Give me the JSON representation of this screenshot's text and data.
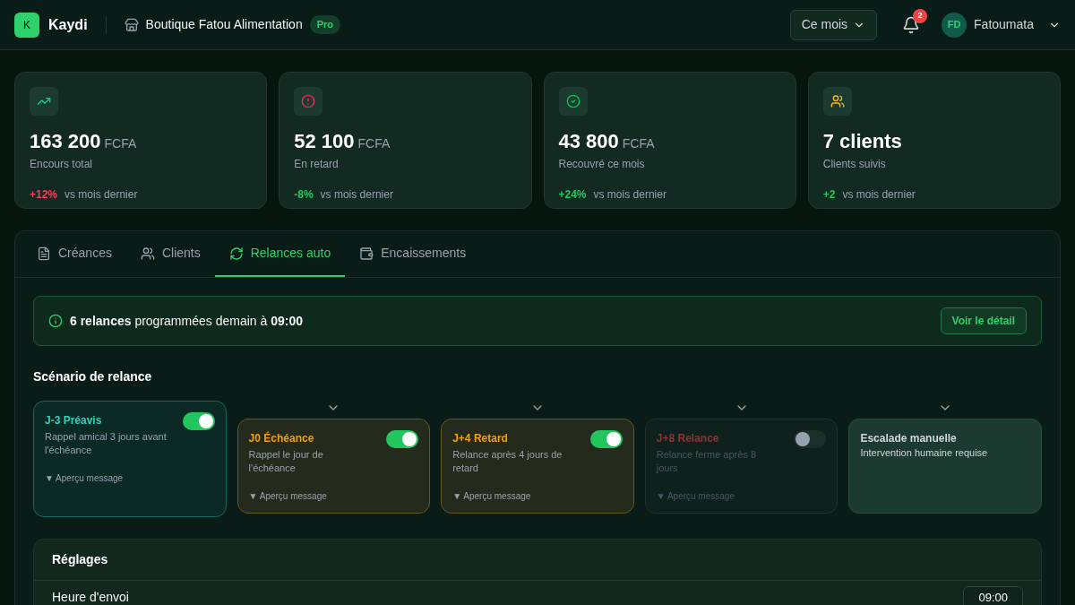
{
  "brand": {
    "logo": "K",
    "name": "Kaydi"
  },
  "shop": {
    "name": "Boutique Fatou Alimentation",
    "badge": "Pro"
  },
  "period": {
    "label": "Ce mois"
  },
  "notifications": {
    "count": "2"
  },
  "user": {
    "initials": "FD",
    "name": "Fatoumata"
  },
  "kpis": [
    {
      "value": "163 200",
      "unit": "FCFA",
      "label": "Encours total",
      "delta": "+12%",
      "color": "#f43f5e",
      "delta_text": "vs mois dernier"
    },
    {
      "value": "52 100",
      "unit": "FCFA",
      "label": "En retard",
      "delta": "-8%",
      "color": "#22c55e",
      "delta_text": "vs mois dernier"
    },
    {
      "value": "43 800",
      "unit": "FCFA",
      "label": "Recouvré ce mois",
      "delta": "+24%",
      "color": "#22c55e",
      "delta_text": "vs mois dernier"
    },
    {
      "value": "7 clients",
      "label": "Clients suivis",
      "delta": "+2",
      "color": "#22c55e",
      "delta_text": "vs mois dernier"
    }
  ],
  "tabs": [
    {
      "label": "Créances",
      "selected": false
    },
    {
      "label": "Clients",
      "selected": false
    },
    {
      "label": "Relances auto",
      "selected": true
    },
    {
      "label": "Encaissements",
      "selected": false
    }
  ],
  "banner": {
    "text": "**6 relances** programmées demain à **09:00**",
    "button": "Voir le détail"
  },
  "scenario": {
    "title": "Scénario de relance",
    "steps": [
      {
        "kind": "step",
        "title": "J-3 Préavis",
        "description": "Rappel amical 3 jours avant l'échéance",
        "preview": "▼ Aperçu message",
        "on": true,
        "color": "#2dd4bf"
      },
      {
        "kind": "step",
        "title": "J0 Échéance",
        "description": "Rappel le jour de l'échéance",
        "preview": "▼ Aperçu message",
        "on": true,
        "color": "#f59e0b"
      },
      {
        "kind": "step",
        "title": "J+4 Retard",
        "description": "Relance après 4 jours de retard",
        "preview": "▼ Aperçu message",
        "on": true,
        "color": "#f59e0b"
      },
      {
        "kind": "step",
        "title": "J+8 Relance",
        "description": "Relance ferme après 8 jours",
        "preview": "▼ Aperçu message",
        "on": false,
        "color": "#8f3434"
      },
      {
        "kind": "manual",
        "title": "Escalade manuelle",
        "description": "Intervention humaine requise"
      }
    ]
  },
  "settings": {
    "title": "Réglages",
    "send_time": {
      "label": "Heure d'envoi",
      "value": "09:00"
    }
  }
}
